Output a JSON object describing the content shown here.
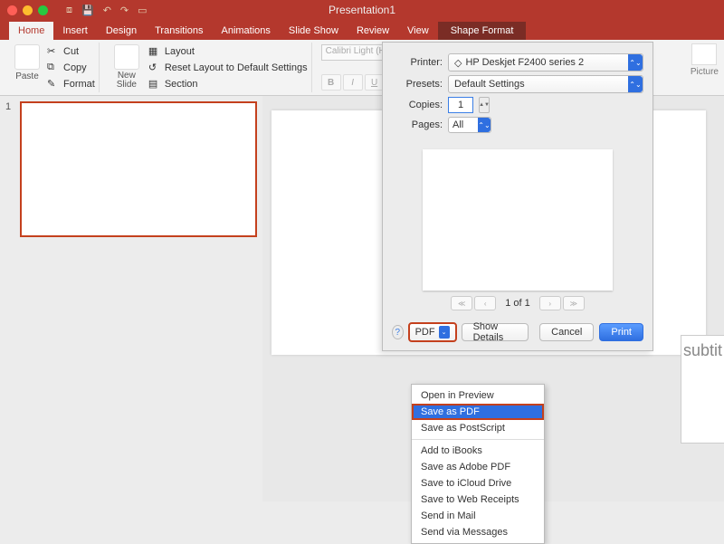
{
  "window": {
    "title": "Presentation1"
  },
  "tabs": {
    "items": [
      "Home",
      "Insert",
      "Design",
      "Transitions",
      "Animations",
      "Slide Show",
      "Review",
      "View"
    ],
    "active": "Home",
    "contextual": "Shape Format"
  },
  "ribbon": {
    "paste": "Paste",
    "cut": "Cut",
    "copy": "Copy",
    "format": "Format",
    "new_slide": "New\nSlide",
    "layout": "Layout",
    "reset": "Reset Layout to Default Settings",
    "section": "Section",
    "font_name": "Calibri Light (Headi...",
    "picture": "Picture"
  },
  "thumbs": {
    "num": "1"
  },
  "canvas": {
    "subtitle_fragment": "subtit"
  },
  "print": {
    "labels": {
      "printer": "Printer:",
      "presets": "Presets:",
      "copies": "Copies:",
      "pages": "Pages:"
    },
    "printer": "HP Deskjet F2400 series 2",
    "presets": "Default Settings",
    "copies": "1",
    "pages": "All",
    "page_of": "1 of 1",
    "pdf": "PDF",
    "show_details": "Show Details",
    "cancel": "Cancel",
    "print_btn": "Print"
  },
  "pdf_menu": {
    "items_top": [
      "Open in Preview",
      "Save as PDF",
      "Save as PostScript"
    ],
    "items_bottom": [
      "Add to iBooks",
      "Save as Adobe PDF",
      "Save to iCloud Drive",
      "Save to Web Receipts",
      "Send in Mail",
      "Send via Messages"
    ],
    "highlighted": "Save as PDF"
  }
}
